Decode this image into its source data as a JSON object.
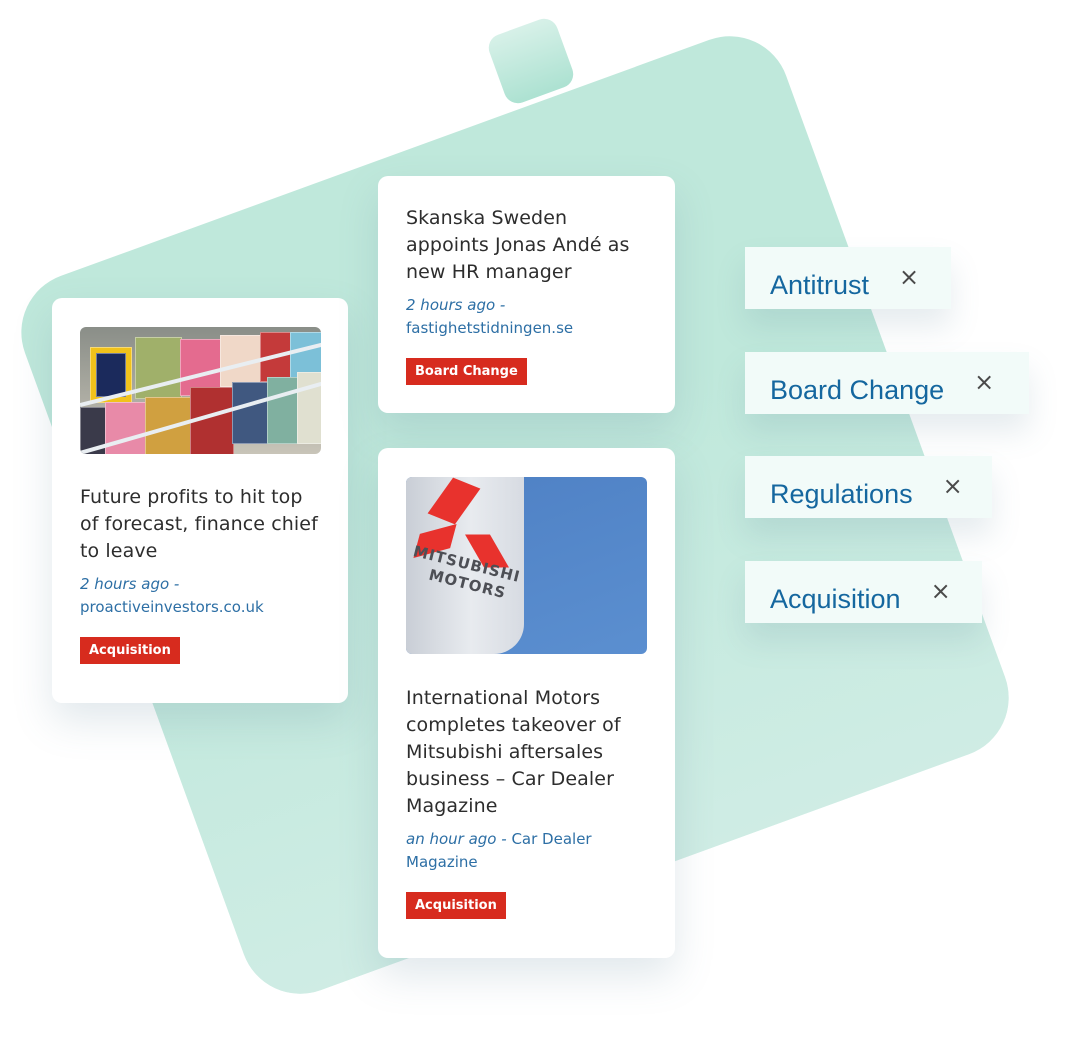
{
  "colors": {
    "background_shape": "#bfe8db",
    "tag_red": "#d72b1e",
    "link_blue": "#2d6fa5",
    "chip_text": "#15679f"
  },
  "articles": [
    {
      "image": "magazine-rack-photo",
      "headline": "Future profits to hit top of forecast, finance chief to leave",
      "time": "2 hours ago -",
      "source": "proactiveinvestors.co.uk",
      "tag": "Acquisition"
    },
    {
      "headline": "Skanska Sweden appoints Jonas Andé as new HR manager",
      "time": "2 hours ago -",
      "source": "fastighetstidningen.se",
      "tag": "Board Change"
    },
    {
      "image": "mitsubishi-motors-sign-photo",
      "image_text": [
        "MITSUBISHI",
        "MOTORS"
      ],
      "headline": "International Motors completes takeover of Mitsubishi aftersales business – Car Dealer Magazine",
      "time": "an hour ago -",
      "source": "Car Dealer Magazine",
      "tag": "Acquisition"
    }
  ],
  "filters": [
    {
      "label": "Antitrust",
      "icon": "close-icon",
      "close": "×"
    },
    {
      "label": "Board Change",
      "icon": "close-icon",
      "close": "×"
    },
    {
      "label": "Regulations",
      "icon": "close-icon",
      "close": "×"
    },
    {
      "label": "Acquisition",
      "icon": "close-icon",
      "close": "×"
    }
  ]
}
